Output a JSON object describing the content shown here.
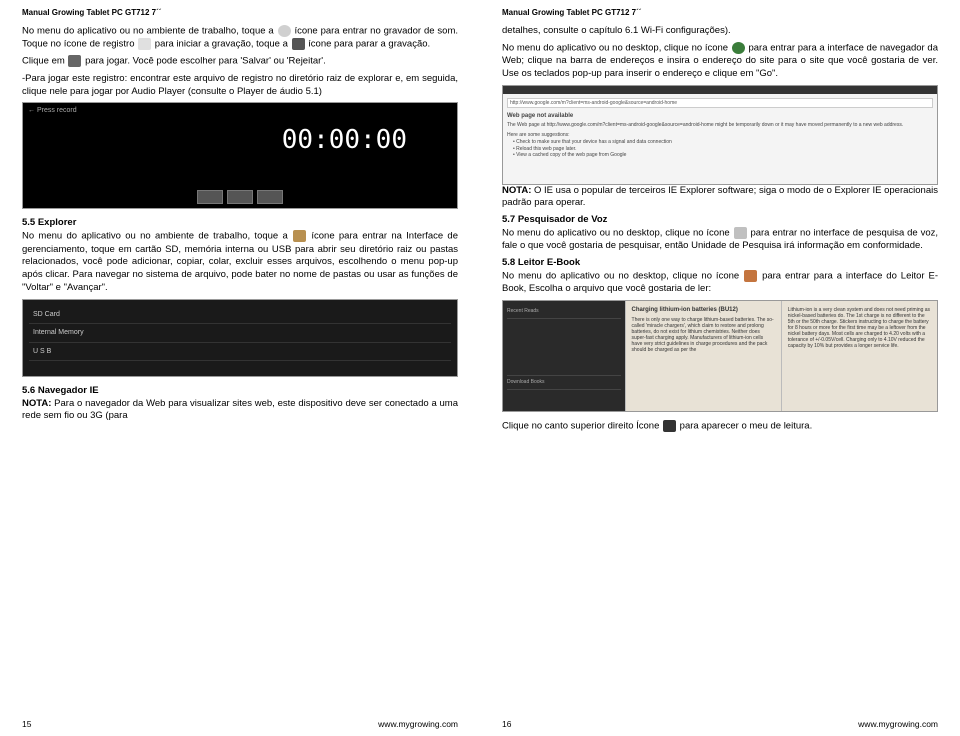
{
  "left": {
    "header": "Manual Growing Tablet PC GT712 7´´",
    "p1a": "No menu do aplicativo ou no ambiente de trabalho, toque a",
    "p1b": "ícone para entrar no gravador de som. Toque no ícone de registro",
    "p1c": "para iniciar a gravação, toque a",
    "p1d": "ícone para parar a gravação.",
    "p2a": "Clique em",
    "p2b": "para jogar. Você pode escolher para 'Salvar' ou 'Rejeitar'.",
    "p3": "-Para jogar este registro: encontrar este arquivo de registro no diretório raiz de explorar e, em seguida, clique nele para jogar por Audio Player (consulte o Player de áudio 5.1)",
    "recorder_label": "← Press record",
    "recorder_time": "00:00:00",
    "s55_title": "5.5 Explorer",
    "s55a": "No menu do aplicativo ou no ambiente de trabalho, toque a",
    "s55b": "ícone para entrar na Interface de gerenciamento, toque em cartão SD, memória interna ou USB para abrir seu diretório raiz ou pastas relacionados, você pode adicionar, copiar, colar, excluir esses arquivos, escolhendo o menu pop-up após clicar. Para navegar no sistema de arquivo, pode bater no nome de pastas ou usar as funções de \"Voltar\" e \"Avançar\".",
    "explorer_items": [
      "SD Card",
      "Internal Memory",
      "U S B"
    ],
    "s56_title": "5.6 Navegador IE",
    "s56_nota": "NOTA:",
    "s56_body": " Para o navegador da Web para visualizar sites web, este dispositivo deve ser conectado a uma rede sem fio ou 3G (para",
    "page_num": "15",
    "footer_url": "www.mygrowing.com"
  },
  "right": {
    "header": "Manual Growing Tablet PC GT712 7´´",
    "p1": "detalhes, consulte o capítulo 6.1 Wi-Fi configurações).",
    "p2a": "No menu do aplicativo ou no desktop, clique no ícone",
    "p2b": "para entrar para a interface de navegador da Web; clique na barra de endereços e insira o endereço do site para o site que você gostaria de ver. Use os teclados pop-up para inserir o endereço e clique em \"Go\".",
    "browser_url": "http://www.google.com/m?client=ms-android-google&source=android-home",
    "browser_title": "Web page not available",
    "browser_body1": "The Web page at http://www.google.com/m?client=ms-android-google&source=android-home might be temporarily down or it may have moved permanently to a new web address.",
    "browser_sugg": "Here are some suggestions:",
    "browser_li1": "• Check to make sure that your device has a signal and data connection",
    "browser_li2": "• Reload this web page later.",
    "browser_li3": "• View a cached copy of the web page from Google",
    "nota2a": "NOTA:",
    "nota2b": " O IE usa o popular de terceiros IE Explorer software; siga o modo de o Explorer IE operacionais padrão para operar.",
    "s57_title": "5.7 Pesquisador de Voz",
    "s57a": "No menu do aplicativo ou no desktop, clique no ícone",
    "s57b": "para entrar no interface de pesquisa de voz, fale o que você gostaria de pesquisar, então Unidade de Pesquisa irá informação em conformidade.",
    "s58_title": "5.8 Leitor E-Book",
    "s58a": "No menu do aplicativo ou no desktop, clique no ícone",
    "s58b": "para entrar para a interface do Leitor E-Book, Escolha o arquivo que você gostaria de ler:",
    "ebook_left": [
      "Recent Reads",
      "",
      "Download Books"
    ],
    "ebook_page1_title": "Charging lithium-ion batteries (BU12)",
    "ebook_page1_body": "There is only one way to charge lithium-based batteries. The so-called 'miracle chargers', which claim to restore and prolong batteries, do not exist for lithium chemistries. Neither does super-fast charging apply. Manufacturers of lithium-ion cells have very strict guidelines in charge procedures and the pack should be charged as per the",
    "ebook_page2_body": "Lithium-ion is a very clean system and does not need priming as nickel-based batteries do. The 1st charge is no different to the 5th or the 50th charge. Stickers instructing to charge the battery for 8 hours or more for the first time may be a leftover from the nickel battery days.\n\nMost cells are charged to 4.20 volts with a tolerance of +/-0.05V/cell. Charging only to 4.10V reduced the capacity by 10% but provides a longer service life.",
    "p_last_a": "Clique no canto superior direito Ícone",
    "p_last_b": "para aparecer o meu de leitura.",
    "page_num": "16",
    "footer_url": "www.mygrowing.com"
  }
}
